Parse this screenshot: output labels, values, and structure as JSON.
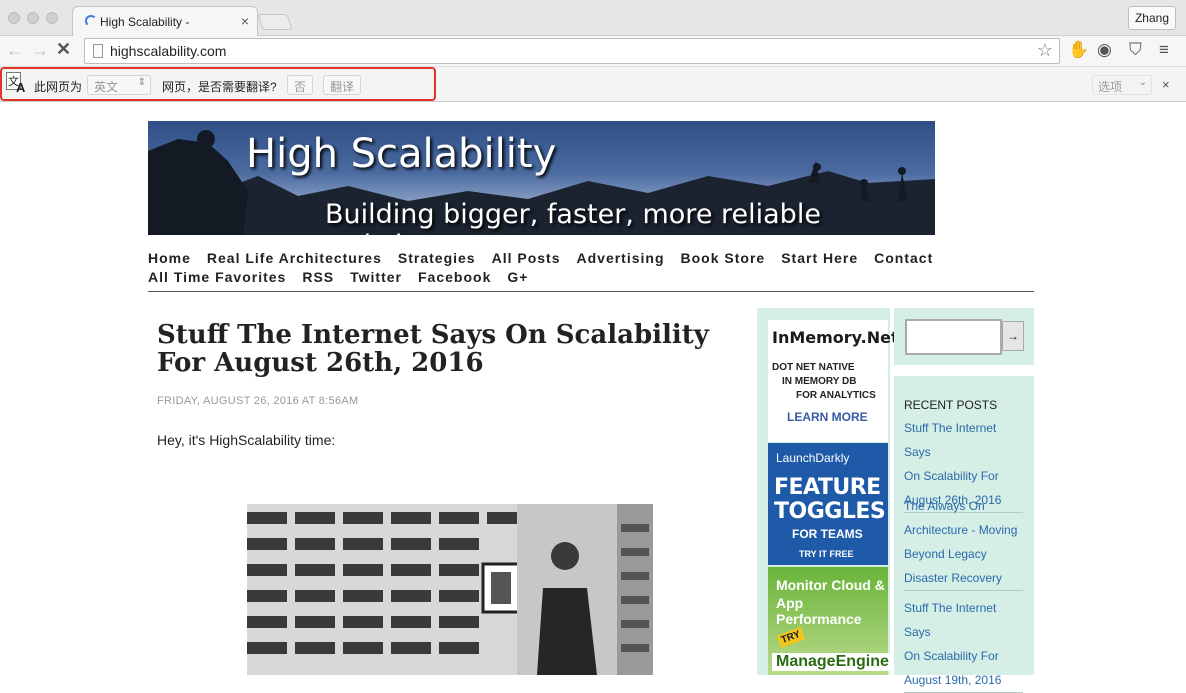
{
  "browser": {
    "tab_title": "High Scalability -",
    "tab_close": "×",
    "user": "Zhang",
    "url": "highscalability.com",
    "nav_back": "←",
    "nav_forward": "→",
    "stop": "✕",
    "star": "☆",
    "menu": "≡"
  },
  "translate_bar": {
    "prefix": "此网页为",
    "language": "英文",
    "question": "网页，是否需要翻译?",
    "no_label": "否",
    "translate_label": "翻译",
    "options_label": "选项",
    "close": "×"
  },
  "site": {
    "title": "High Scalability",
    "tagline": "Building bigger, faster, more reliable websites."
  },
  "nav": {
    "row1": [
      "Home",
      "Real Life Architectures",
      "Strategies",
      "All Posts",
      "Advertising",
      "Book Store",
      "Start Here",
      "Contact"
    ],
    "row2": [
      "All Time Favorites",
      "RSS",
      "Twitter",
      "Facebook",
      "G+"
    ]
  },
  "post": {
    "title": "Stuff The Internet Says On Scalability For August 26th, 2016",
    "date": "FRIDAY, AUGUST 26, 2016 AT 8:56AM",
    "intro": "Hey, it's HighScalability time:"
  },
  "ads": {
    "inmemory": {
      "heading": "InMemory.Net",
      "line1": "DOT NET NATIVE",
      "line2": "IN MEMORY DB",
      "line3": "FOR ANALYTICS",
      "cta": "LEARN MORE"
    },
    "launchdarkly": {
      "logo": "LaunchDarkly",
      "line1": "FEATURE",
      "line2": "TOGGLES",
      "line3": "FOR TEAMS",
      "cta": "TRY IT FREE"
    },
    "manageengine": {
      "line1": "Monitor Cloud &",
      "line2": "App Performance",
      "badge": "TRY",
      "brand": "ManageEngine"
    }
  },
  "sidebar": {
    "search_button": "→",
    "recent_heading": "RECENT POSTS",
    "recent_items": [
      [
        "Stuff The Internet Says",
        "On Scalability For",
        "August 26th, 2016"
      ],
      [
        "The Always On",
        "Architecture - Moving",
        "Beyond Legacy",
        "Disaster Recovery"
      ],
      [
        "Stuff The Internet Says",
        "On Scalability For",
        "August 19th, 2016"
      ]
    ]
  },
  "colors": {
    "highlight_border": "#e0352e",
    "sidebar_bg": "#d5eee6",
    "link": "#2a6aaa"
  }
}
